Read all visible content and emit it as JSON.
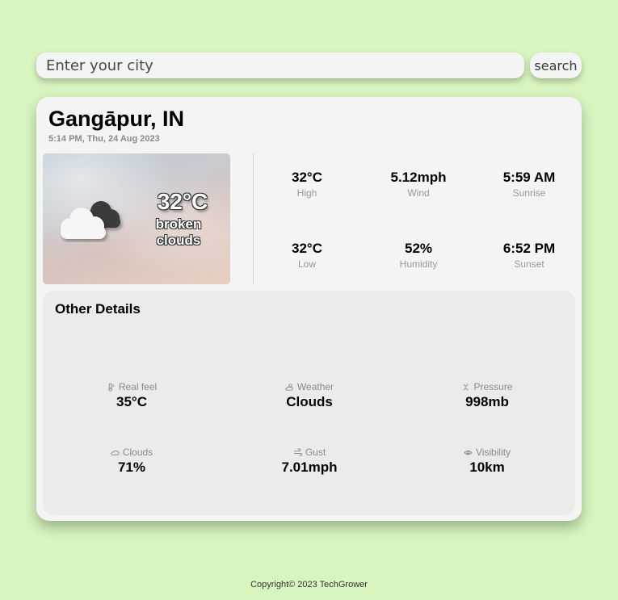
{
  "search": {
    "placeholder": "Enter your city",
    "button_label": "search"
  },
  "location": {
    "city": "Gangāpur, IN",
    "datetime": "5:14 PM, Thu, 24 Aug 2023"
  },
  "current": {
    "temp": "32°C",
    "description": "broken clouds",
    "icon": "broken-clouds-icon"
  },
  "stats": [
    {
      "value": "32°C",
      "label": "High"
    },
    {
      "value": "5.12mph",
      "label": "Wind"
    },
    {
      "value": "5:59 AM",
      "label": "Sunrise"
    },
    {
      "value": "32°C",
      "label": "Low"
    },
    {
      "value": "52%",
      "label": "Humidity"
    },
    {
      "value": "6:52 PM",
      "label": "Sunset"
    }
  ],
  "other_details": {
    "title": "Other Details",
    "items": [
      {
        "label": "Real feel",
        "value": "35°C",
        "icon": "thermometer-icon"
      },
      {
        "label": "Weather",
        "value": "Clouds",
        "icon": "sun-cloud-icon"
      },
      {
        "label": "Pressure",
        "value": "998mb",
        "icon": "pressure-icon"
      },
      {
        "label": "Clouds",
        "value": "71%",
        "icon": "cloud-icon"
      },
      {
        "label": "Gust",
        "value": "7.01mph",
        "icon": "wind-icon"
      },
      {
        "label": "Visibility",
        "value": "10km",
        "icon": "eye-icon"
      }
    ]
  },
  "footer": {
    "text": "Copyright© 2023 TechGrower"
  },
  "colors": {
    "background": "#d8f5c0",
    "card": "#f4f4f4",
    "panel": "#ebebeb",
    "muted": "#999999"
  }
}
